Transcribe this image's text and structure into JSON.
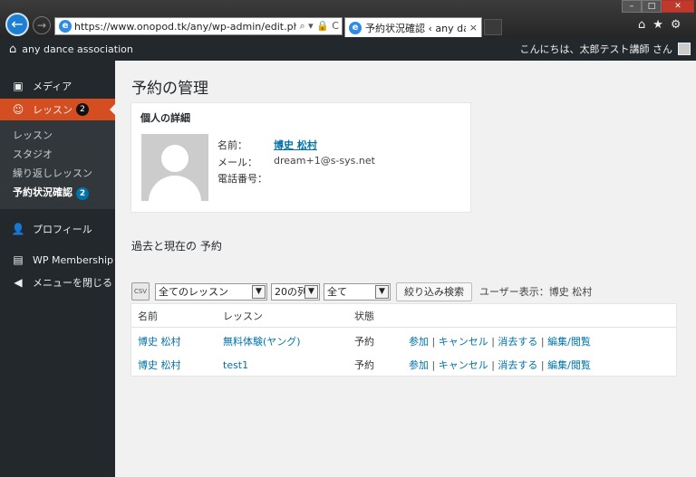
{
  "browser": {
    "url": "https://www.onopod.tk/any/wp-admin/edit.php?post_ty",
    "tab_title": "予約状況確認 ‹ any danc...",
    "tab_close": "×",
    "addr_actions": "⌕ ▾ 🔒 C",
    "window_buttons": {
      "min": "–",
      "max": "□",
      "close": "✕"
    }
  },
  "adminbar": {
    "site_name": "any dance association",
    "greeting": "こんにちは、太郎テスト講師 さん"
  },
  "sidebar": {
    "media": "メディア",
    "lesson": "レッスン",
    "lesson_badge": "2",
    "submenu": [
      {
        "label": "レッスン"
      },
      {
        "label": "スタジオ"
      },
      {
        "label": "繰り返しレッスン"
      },
      {
        "label": "予約状況確認",
        "badge": "2"
      }
    ],
    "profile": "プロフィール",
    "wp_membership": "WP Membership",
    "collapse": "メニューを閉じる"
  },
  "main": {
    "title": "予約の管理",
    "details": {
      "heading": "個人の詳細",
      "name_label": "名前：",
      "name_value": "博史 松村",
      "mail_label": "メール：",
      "mail_value": "dream+1@s-sys.net",
      "phone_label": "電話番号：",
      "phone_value": ""
    },
    "section_heading": "過去と現在の 予約",
    "filters": {
      "csv": "CSV",
      "lesson_select": "全てのレッスン",
      "count_select": "20の列",
      "status_select": "全て",
      "filter_button": "絞り込み検索",
      "user_view": "ユーザー表示：博史 松村"
    },
    "table": {
      "headers": [
        "名前",
        "レッスン",
        "状態",
        ""
      ],
      "rows": [
        {
          "name": "博史 松村",
          "lesson": "無料体験(ヤング)",
          "status": "予約",
          "actions": [
            "参加",
            "キャンセル",
            "消去する",
            "編集/閲覧"
          ]
        },
        {
          "name": "博史 松村",
          "lesson": "test1",
          "status": "予約",
          "actions": [
            "参加",
            "キャンセル",
            "消去する",
            "編集/閲覧"
          ]
        }
      ]
    }
  },
  "colors": {
    "accent": "#d54e21",
    "admin_bg": "#23282d",
    "link": "#0073aa"
  }
}
